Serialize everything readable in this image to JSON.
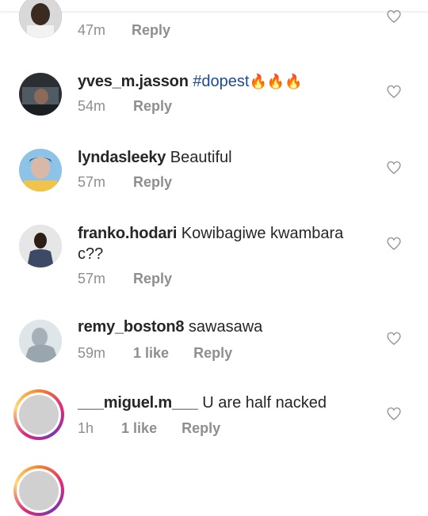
{
  "comments": [
    {
      "username": "",
      "text": "",
      "emoji": "",
      "time": "47m",
      "likes": "",
      "reply": "Reply"
    },
    {
      "username": "yves_m.jasson",
      "hashtag": "#dopest",
      "emoji": "🔥🔥🔥",
      "time": "54m",
      "likes": "",
      "reply": "Reply"
    },
    {
      "username": "lyndasleeky",
      "text": "Beautiful",
      "time": "57m",
      "likes": "",
      "reply": "Reply"
    },
    {
      "username": "franko.hodari",
      "text": "Kowibagiwe kwambara c??",
      "time": "57m",
      "likes": "",
      "reply": "Reply"
    },
    {
      "username": "remy_boston8",
      "text": "sawasawa",
      "time": "59m",
      "likes": "1 like",
      "reply": "Reply"
    },
    {
      "username": "___miguel.m___",
      "text": "U are half nacked",
      "time": "1h",
      "likes": "1 like",
      "reply": "Reply"
    }
  ],
  "colors": {
    "hashtag": "#1e4a8f",
    "meta": "#8e8e8e",
    "text": "#262626",
    "fire": "#f26a1b"
  },
  "icons": {
    "like": "heart-outline-icon"
  }
}
